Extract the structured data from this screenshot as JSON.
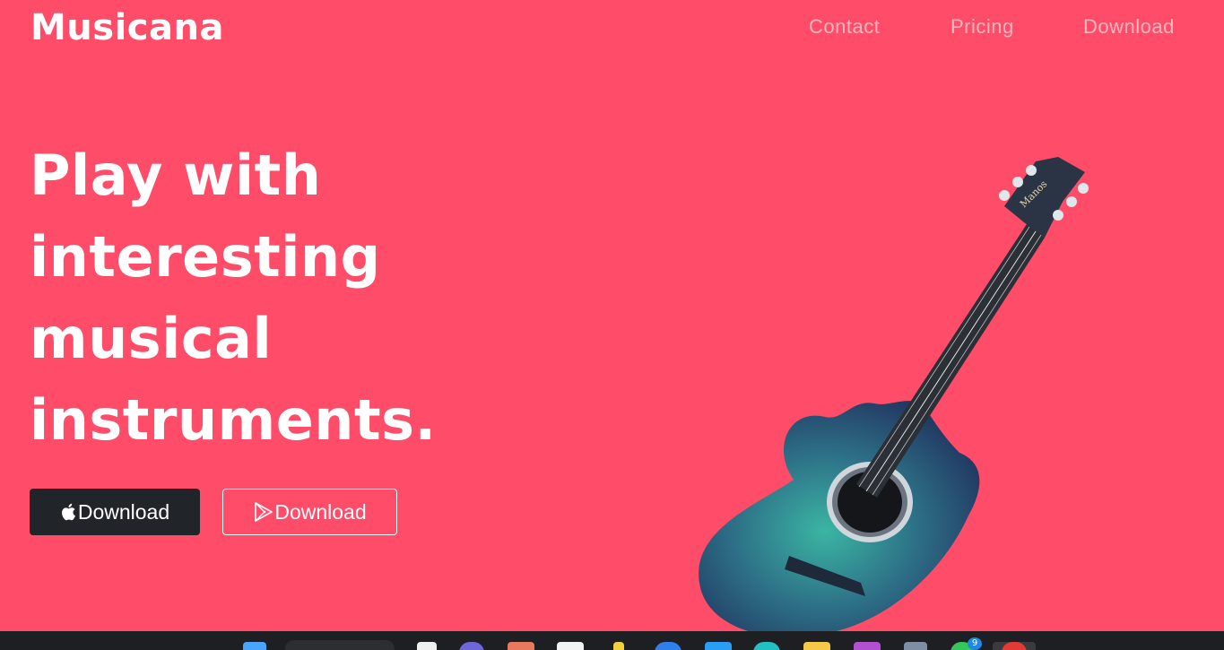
{
  "brand": {
    "name": "Musicana"
  },
  "nav": {
    "links": [
      {
        "label": "Contact"
      },
      {
        "label": "Pricing"
      },
      {
        "label": "Download"
      }
    ]
  },
  "hero": {
    "title_lines": [
      "Play with",
      "interesting",
      "musical",
      "instruments."
    ],
    "buttons": [
      {
        "label": "Download",
        "icon": "apple-icon"
      },
      {
        "label": "Download",
        "icon": "google-play-icon"
      }
    ]
  },
  "guitar_image": {
    "brand_text": "Manos"
  },
  "taskbar": {
    "notification_count": "9"
  },
  "colors": {
    "background": "#ff4c68",
    "dark_button": "#212529",
    "text": "#ffffff"
  }
}
